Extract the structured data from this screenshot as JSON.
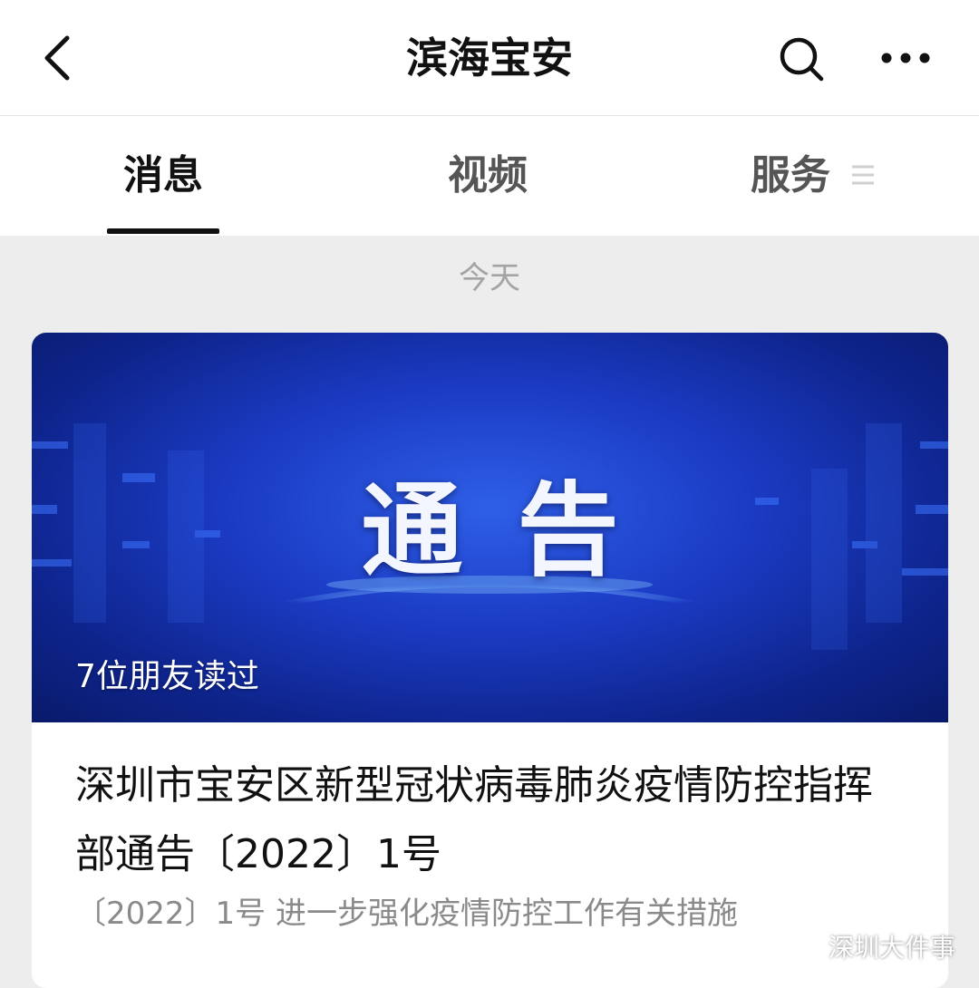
{
  "nav": {
    "title": "滨海宝安",
    "back_icon": "chevron-left-icon",
    "search_icon": "search-icon",
    "more_icon": "more-dots-icon"
  },
  "tabs": [
    {
      "label": "消息",
      "active": true
    },
    {
      "label": "视频",
      "active": false
    },
    {
      "label": "服务",
      "active": false,
      "icon": "menu-lines-icon"
    }
  ],
  "feed": {
    "date_label": "今天",
    "card": {
      "banner_text": "通告",
      "readers": "7位朋友读过",
      "title": "深圳市宝安区新型冠状病毒肺炎疫情防控指挥部通告〔2022〕1号",
      "summary": "〔2022〕1号 进一步强化疫情防控工作有关措施"
    }
  },
  "watermark": {
    "text": "深圳大件事",
    "icon": "wechat-icon"
  },
  "colors": {
    "banner_blue": "#1b3bc4",
    "background": "#ededed",
    "tab_underline": "#111111"
  }
}
